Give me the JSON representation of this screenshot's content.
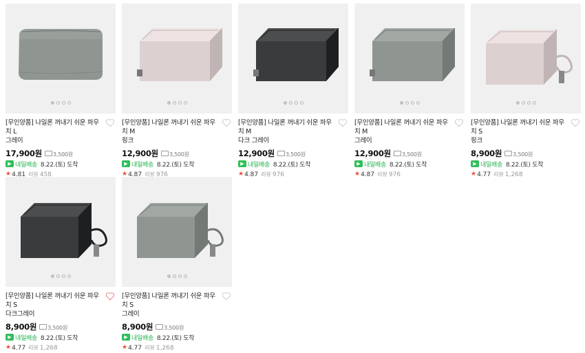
{
  "colors": {
    "gray": "#8f9590",
    "pink": "#ddd0d0",
    "dark": "#3a3b3c",
    "green": "#2fbf5a",
    "star": "#f04b3a",
    "heart_active": "#f07a7a"
  },
  "products": [
    {
      "title_line1": "[무인양품] 나일론 꺼내기 쉬운 파우치 L",
      "title_line2": "그레이",
      "price": "17,900원",
      "coupon": "3,500원",
      "ship_label": "내일배송",
      "ship_date": "8.22.(토) 도착",
      "rating": "4.81",
      "review_label": "리뷰",
      "review_count": "458",
      "color": "gray",
      "size": "L",
      "wishlisted": false
    },
    {
      "title_line1": "[무인양품] 나일론 꺼내기 쉬운 파우치 M",
      "title_line2": "핑크",
      "price": "12,900원",
      "coupon": "3,500원",
      "ship_label": "내일배송",
      "ship_date": "8.22.(토) 도착",
      "rating": "4.87",
      "review_label": "리뷰",
      "review_count": "976",
      "color": "pink",
      "size": "M",
      "wishlisted": false
    },
    {
      "title_line1": "[무인양품] 나일론 꺼내기 쉬운 파우치 M",
      "title_line2": "다크 그레이",
      "price": "12,900원",
      "coupon": "3,500원",
      "ship_label": "내일배송",
      "ship_date": "8.22.(토) 도착",
      "rating": "4.87",
      "review_label": "리뷰",
      "review_count": "976",
      "color": "dark",
      "size": "M",
      "wishlisted": false
    },
    {
      "title_line1": "[무인양품] 나일론 꺼내기 쉬운 파우치 M",
      "title_line2": "그레이",
      "price": "12,900원",
      "coupon": "3,500원",
      "ship_label": "내일배송",
      "ship_date": "8.22.(토) 도착",
      "rating": "4.87",
      "review_label": "리뷰",
      "review_count": "976",
      "color": "gray",
      "size": "M",
      "wishlisted": false
    },
    {
      "title_line1": "[무인양품] 나일론 꺼내기 쉬운 파우치 S",
      "title_line2": "핑크",
      "price": "8,900원",
      "coupon": "3,500원",
      "ship_label": "내일배송",
      "ship_date": "8.22.(토) 도착",
      "rating": "4.77",
      "review_label": "리뷰",
      "review_count": "1,268",
      "color": "pink",
      "size": "S",
      "wishlisted": false
    },
    {
      "title_line1": "[무인양품] 나일론 꺼내기 쉬운 파우치 S",
      "title_line2": "다크그레이",
      "price": "8,900원",
      "coupon": "3,500원",
      "ship_label": "내일배송",
      "ship_date": "8.22.(토) 도착",
      "rating": "4.77",
      "review_label": "리뷰",
      "review_count": "1,268",
      "color": "dark",
      "size": "S",
      "wishlisted": true
    },
    {
      "title_line1": "[무인양품] 나일론 꺼내기 쉬운 파우치 S",
      "title_line2": "그레이",
      "price": "8,900원",
      "coupon": "3,500원",
      "ship_label": "내일배송",
      "ship_date": "8.22.(토) 도착",
      "rating": "4.77",
      "review_label": "리뷰",
      "review_count": "1,268",
      "color": "gray",
      "size": "S",
      "wishlisted": false
    }
  ]
}
